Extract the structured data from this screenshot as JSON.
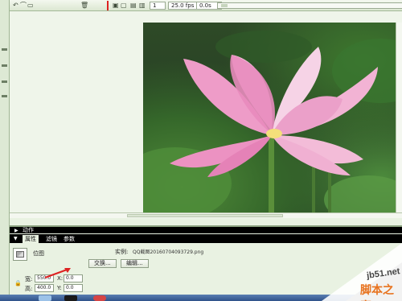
{
  "toolbar": {
    "frame_number": "1",
    "fps": "25.0 fps",
    "elapsed": "0.0s"
  },
  "panels": {
    "actions_label": "动作",
    "tabs": [
      {
        "label": "属性",
        "active": true
      },
      {
        "label": "滤镜",
        "active": false
      },
      {
        "label": "参数",
        "active": false
      }
    ]
  },
  "properties": {
    "symbol_type": "位图",
    "instance_label": "实例:",
    "instance_name": "QQ截图20160704093729.png",
    "swap_button": "交换...",
    "edit_button": "编辑...",
    "width_label": "宽:",
    "width_value": "550.0",
    "height_label": "高:",
    "height_value": "400.0",
    "x_label": "X:",
    "x_value": "0.0",
    "y_label": "Y:",
    "y_value": "0.0"
  },
  "watermark": {
    "url": "jb51.net",
    "site_name": "脚本之家"
  },
  "colors": {
    "ui_green": "#e9f2e2",
    "panel_black": "#000000",
    "accent_red": "#d22222",
    "watermark_orange": "#e8731f"
  }
}
